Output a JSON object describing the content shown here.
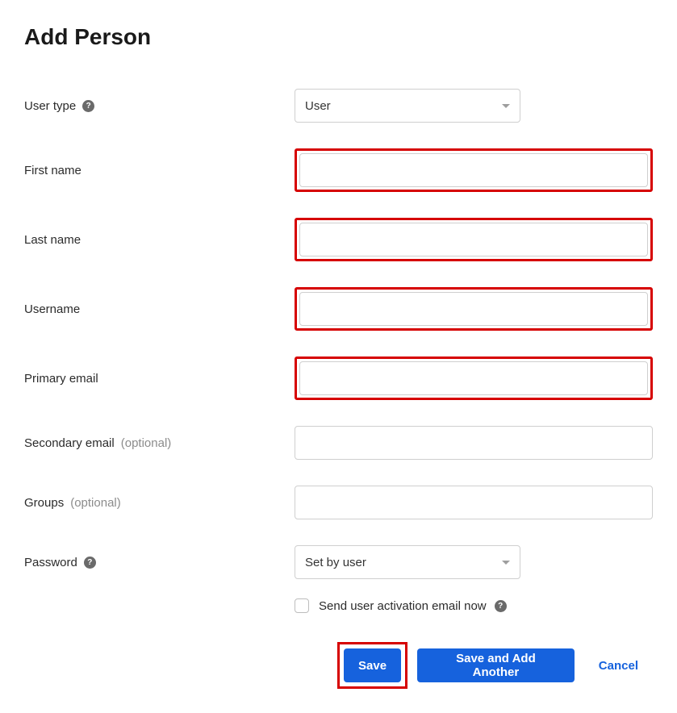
{
  "title": "Add Person",
  "fields": {
    "userType": {
      "label": "User type",
      "value": "User",
      "hasHelp": true
    },
    "firstName": {
      "label": "First name",
      "value": "",
      "highlighted": true
    },
    "lastName": {
      "label": "Last name",
      "value": "",
      "highlighted": true
    },
    "username": {
      "label": "Username",
      "value": "",
      "highlighted": true
    },
    "primaryEmail": {
      "label": "Primary email",
      "value": "",
      "highlighted": true
    },
    "secondaryEmail": {
      "label": "Secondary email",
      "optional": "(optional)",
      "value": ""
    },
    "groups": {
      "label": "Groups",
      "optional": "(optional)",
      "value": ""
    },
    "password": {
      "label": "Password",
      "value": "Set by user",
      "hasHelp": true
    }
  },
  "activation": {
    "label": "Send user activation email now",
    "checked": false,
    "hasHelp": true
  },
  "buttons": {
    "save": "Save",
    "saveAddAnother": "Save and Add Another",
    "cancel": "Cancel"
  }
}
